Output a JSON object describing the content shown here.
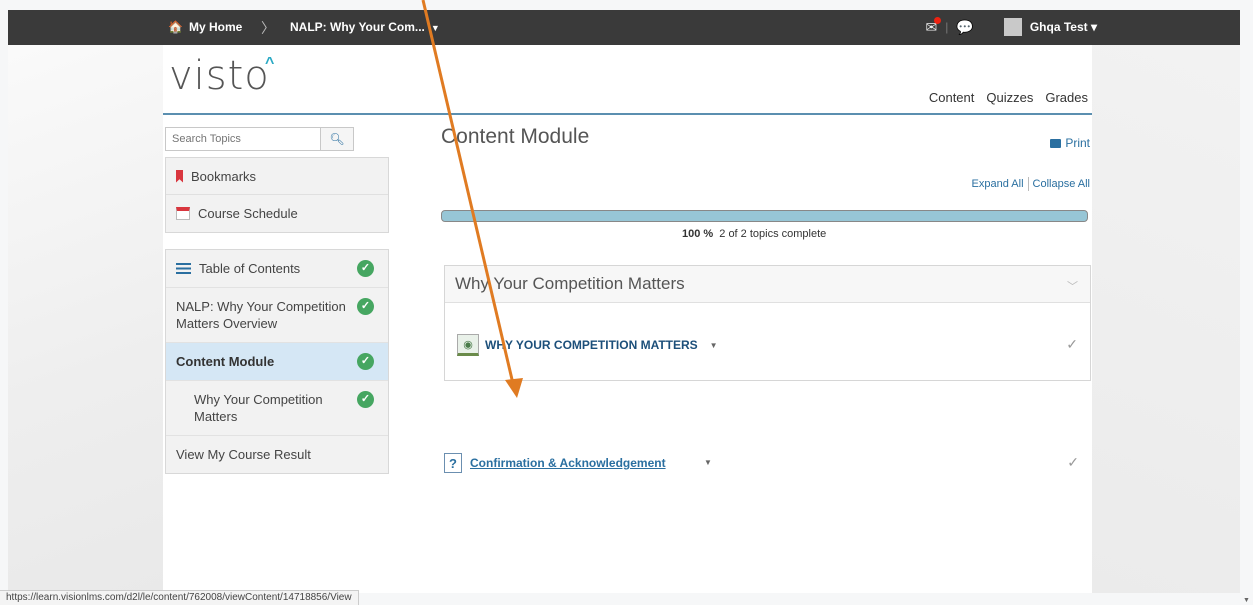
{
  "nav": {
    "home": "My Home",
    "separator": "〉",
    "course": "NALP: Why Your Com...",
    "username": "Ghqa Test"
  },
  "logo": "visto",
  "tabs": [
    "Content",
    "Quizzes",
    "Grades"
  ],
  "sidebar": {
    "search_placeholder": "Search Topics",
    "bookmarks": "Bookmarks",
    "schedule": "Course Schedule",
    "toc": {
      "header": "Table of Contents",
      "items": [
        {
          "label": "NALP: Why Your Competition Matters Overview"
        },
        {
          "label": "Content Module"
        },
        {
          "label": "Why Your Competition Matters"
        },
        {
          "label": "View My Course Result"
        }
      ]
    }
  },
  "main": {
    "title": "Content Module",
    "print": "Print",
    "expand_all": "Expand All",
    "collapse_all": "Collapse All",
    "progress": {
      "percent_label": "100 %",
      "value": 100,
      "detail": "2 of 2 topics complete"
    },
    "module": {
      "title": "Why Your Competition Matters",
      "topic": "WHY YOUR COMPETITION MATTERS"
    },
    "quiz": "Confirmation & Acknowledgement"
  },
  "status_url": "https://learn.visionlms.com/d2l/le/content/762008/viewContent/14718856/View",
  "colors": {
    "topbar": "#3a3a3a",
    "accent": "#2a6fa0",
    "check": "#46a661",
    "annotation_arrow": "#e07b22",
    "progress": "#97c6d6"
  }
}
